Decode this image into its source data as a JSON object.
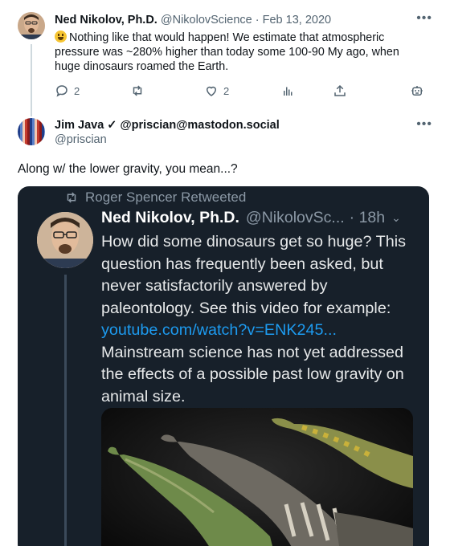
{
  "tweet1": {
    "name": "Ned Nikolov, Ph.D.",
    "handle": "@NikolovScience",
    "separator": "·",
    "date": "Feb 13, 2020",
    "text": "Nothing like that would happen! We estimate that atmospheric pressure was ~280% higher than today some 100-90 My ago, when huge dinosaurs roamed the Earth.",
    "more_icon": "more-dots-icon",
    "actions": {
      "reply_count": "2",
      "like_count": "2"
    }
  },
  "tweet2": {
    "name": "Jim Java ✓ @priscian@mastodon.social",
    "handle": "@priscian",
    "text": "Along w/ the lower gravity, you mean...?"
  },
  "embed": {
    "retweeted_by": "Roger Spencer Retweeted",
    "name": "Ned Nikolov, Ph.D.",
    "handle": "@NikolovSc...",
    "time": "· 18h",
    "text_before_link": "How did some dinosaurs get so huge? This question has frequently been asked, but never satisfactorily answered by paleontology. See this video for example:",
    "link": "youtube.com/watch?v=ENK245...",
    "text_after_link": "Mainstream science has not yet addressed the effects of a possible past low gravity on animal size."
  },
  "colors": {
    "accent": "#1d9bf0",
    "muted": "#536471",
    "embed_bg": "#17202a"
  }
}
